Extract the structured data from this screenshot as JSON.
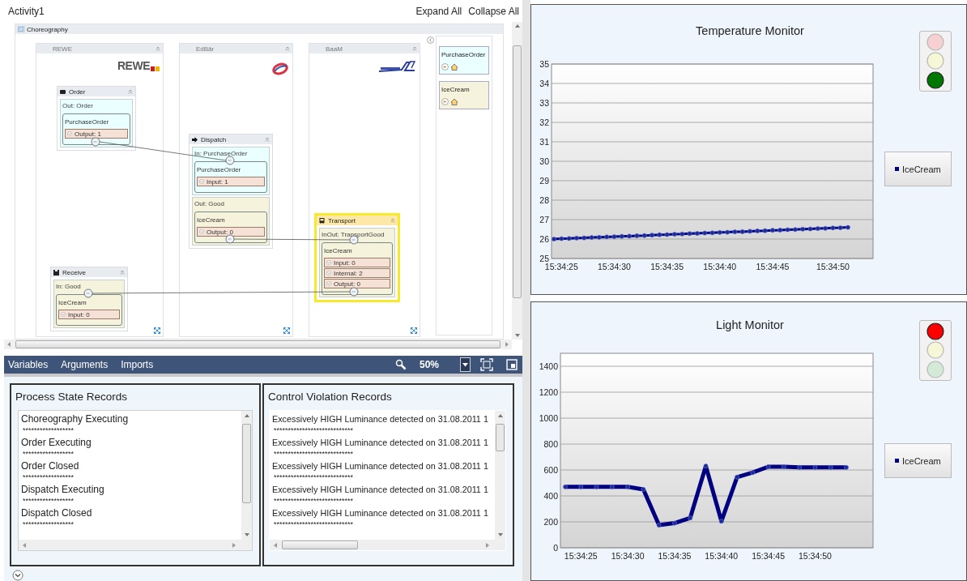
{
  "window": {
    "title": "Activity1"
  },
  "header_actions": [
    {
      "label": "Expand All"
    },
    {
      "label": "Collapse All"
    }
  ],
  "designer": {
    "title": "Choreography",
    "lanes": [
      {
        "title": "REWE",
        "logo_text": "REWE",
        "nodes": [
          {
            "title": "Order",
            "selected": false,
            "sections": [
              {
                "label": "Out: Order",
                "color": "#eaffff",
                "message": "PurchaseOrder",
                "fields": [
                  "Output: 1"
                ]
              }
            ]
          },
          {
            "title": "Receive",
            "selected": false,
            "sections": [
              {
                "label": "In: Good",
                "color": "#f5f3db",
                "message": "IceCream",
                "fields": [
                  "Input: 0"
                ]
              }
            ]
          }
        ]
      },
      {
        "title": "EdBär",
        "nodes": [
          {
            "title": "Dispatch",
            "selected": false,
            "sections": [
              {
                "label": "In: PurchaseOrder",
                "color": "#eaffff",
                "message": "PurchaseOrder",
                "fields": [
                  "Input: 1"
                ]
              },
              {
                "label": "Out: Good",
                "color": "#f5f3db",
                "message": "IceCream",
                "fields": [
                  "Output: 0"
                ]
              }
            ]
          }
        ]
      },
      {
        "title": "BaaM",
        "nodes": [
          {
            "title": "Transport",
            "selected": true,
            "sections": [
              {
                "label": "InOut: TransportGood",
                "color": "#f5f3db",
                "message": "IceCream",
                "fields": [
                  "Input: 0",
                  "Internal: 2",
                  "Output: 0"
                ]
              }
            ]
          }
        ]
      }
    ],
    "messages": [
      {
        "label": "PurchaseOrder",
        "color": "#eaffff"
      },
      {
        "label": "IceCream",
        "color": "#f5f3db"
      }
    ]
  },
  "toolbar": {
    "tabs": [
      {
        "label": "Variables"
      },
      {
        "label": "Arguments"
      },
      {
        "label": "Imports"
      }
    ],
    "zoom": "50%"
  },
  "records": [
    {
      "title": "Process State Records",
      "items": [
        {
          "text": "Choreography Executing",
          "separator": "******************"
        },
        {
          "text": "Order Executing",
          "separator": "******************"
        },
        {
          "text": "Order Closed",
          "separator": "******************"
        },
        {
          "text": "Dispatch Executing",
          "separator": "******************"
        },
        {
          "text": "Dispatch Closed",
          "separator": "******************"
        }
      ]
    },
    {
      "title": "Control Violation Records",
      "items": [
        {
          "text": "Excessively HIGH Luminance detected on 31.08.2011 1",
          "separator": "****************************"
        },
        {
          "text": "Excessively HIGH Luminance detected on 31.08.2011 1",
          "separator": "****************************"
        },
        {
          "text": "Excessively HIGH Luminance detected on 31.08.2011 1",
          "separator": "****************************"
        },
        {
          "text": "Excessively HIGH Luminance detected on 31.08.2011 1",
          "separator": "****************************"
        },
        {
          "text": "Excessively HIGH Luminance detected on 31.08.2011 1",
          "separator": "****************************"
        }
      ]
    }
  ],
  "monitors": [
    {
      "title": "Temperature Monitor",
      "lights": [
        {
          "kind": "red",
          "on": false
        },
        {
          "kind": "yellow",
          "on": false
        },
        {
          "kind": "green",
          "on": true
        }
      ],
      "chart_data": {
        "type": "line",
        "categories": [
          null,
          "15:34:25",
          null,
          null,
          null,
          null,
          null,
          null,
          "15:34:30",
          null,
          null,
          null,
          null,
          null,
          null,
          "15:34:35",
          null,
          null,
          null,
          null,
          null,
          null,
          "15:34:40",
          null,
          null,
          null,
          null,
          null,
          null,
          "15:34:45",
          null,
          null,
          null,
          null,
          null,
          null,
          null,
          "15:34:50",
          null,
          null
        ],
        "grid": true,
        "series": [
          {
            "name": "IceCream",
            "color": "#000080",
            "marker": true,
            "values": [
              26.0,
              26.02,
              26.03,
              26.05,
              26.06,
              26.08,
              26.09,
              26.11,
              26.12,
              26.14,
              26.15,
              26.17,
              26.18,
              26.2,
              26.22,
              26.23,
              26.25,
              26.26,
              26.28,
              26.29,
              26.31,
              26.32,
              26.34,
              26.35,
              26.37,
              26.38,
              26.4,
              26.42,
              26.43,
              26.45,
              26.46,
              26.48,
              26.49,
              26.51,
              26.52,
              26.54,
              26.55,
              26.57,
              26.58,
              26.6
            ]
          }
        ],
        "ylim": [
          25,
          35
        ],
        "yticks": [
          25,
          26,
          27,
          28,
          29,
          30,
          31,
          32,
          33,
          34,
          35
        ]
      }
    },
    {
      "title": "Light Monitor",
      "lights": [
        {
          "kind": "red",
          "on": true
        },
        {
          "kind": "yellow",
          "on": false
        },
        {
          "kind": "green",
          "on": false
        }
      ],
      "chart_data": {
        "type": "line",
        "categories": [
          null,
          "15:34:25",
          null,
          null,
          "15:34:30",
          null,
          null,
          "15:34:35",
          null,
          null,
          "15:34:40",
          null,
          null,
          "15:34:45",
          null,
          null,
          "15:34:50",
          null,
          null
        ],
        "grid": true,
        "series": [
          {
            "name": "IceCream",
            "color": "#000080",
            "marker": true,
            "values": [
              470,
              470,
              470,
              470,
              470,
              450,
              175,
              190,
              230,
              630,
              205,
              545,
              580,
              625,
              625,
              620,
              620,
              620,
              620
            ]
          }
        ],
        "ylim": [
          0,
          1500
        ],
        "yticks": [
          0,
          200,
          400,
          600,
          800,
          1000,
          1200,
          1400
        ]
      }
    }
  ]
}
